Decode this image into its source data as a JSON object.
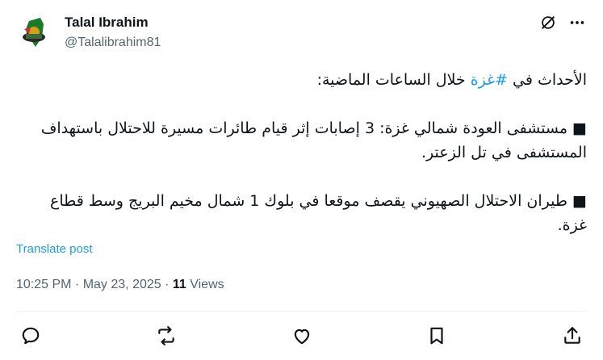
{
  "author": {
    "name": "Talal Ibrahim",
    "handle": "@Talalibrahim81"
  },
  "tweet": {
    "line1_prefix": "الأحداث في ",
    "hashtag": "#غزة",
    "line1_suffix": " خلال الساعات الماضية:",
    "para2": "■ مستشفى العودة شمالي غزة: 3 إصابات إثر قيام طائرات مسيرة للاحتلال باستهداف المستشفى في تل الزعتر.",
    "para3": "■ طيران الاحتلال الصهيوني يقصف موقعا في بلوك 1 شمال مخيم البريج وسط قطاع غزة."
  },
  "translate_label": "Translate post",
  "meta": {
    "time": "10:25 PM",
    "sep1": " · ",
    "date": "May 23, 2025",
    "sep2": " · ",
    "views_count": "11",
    "views_label": " Views"
  },
  "icons": {
    "grok": "grok-icon",
    "more": "more-icon",
    "reply": "reply-icon",
    "retweet": "retweet-icon",
    "like": "like-icon",
    "bookmark": "bookmark-icon",
    "share": "share-icon"
  },
  "colors": {
    "link": "#1d9bf0",
    "secondary_text": "#536471",
    "primary_text": "#0f1419"
  }
}
